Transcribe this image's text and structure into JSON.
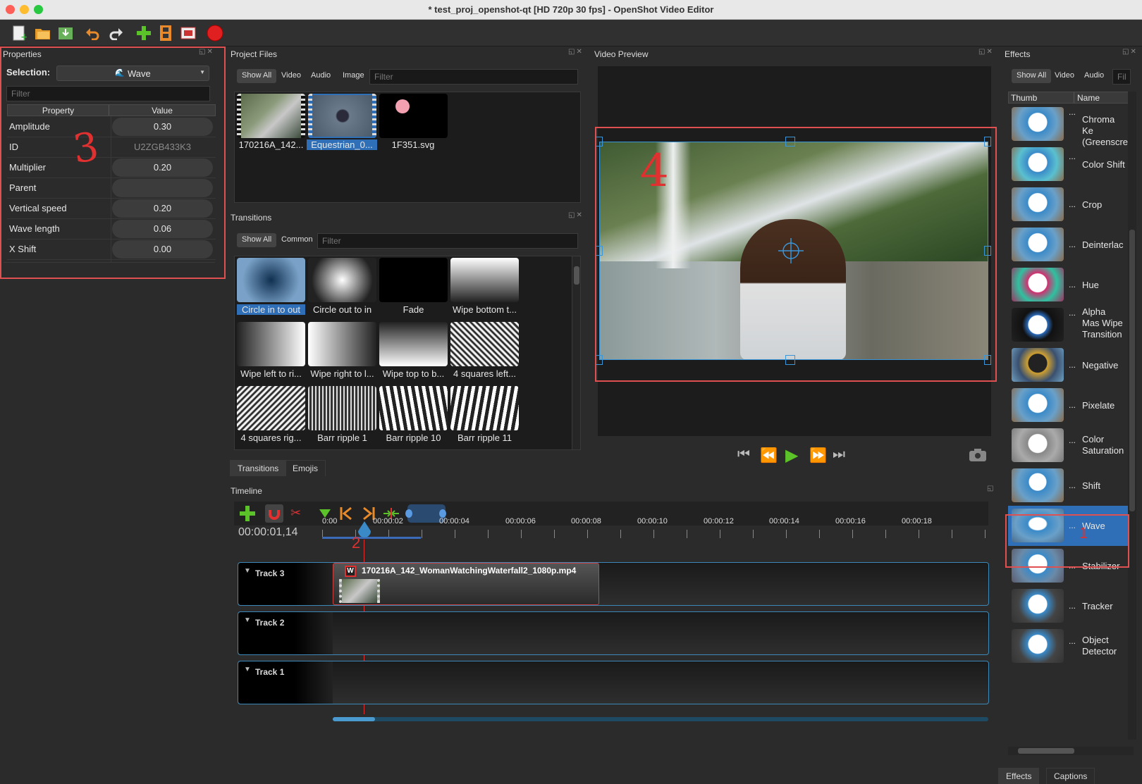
{
  "window": {
    "title": "* test_proj_openshot-qt [HD 720p 30 fps] - OpenShot Video Editor"
  },
  "toolbar": {
    "icons": [
      "new-project-icon",
      "open-project-icon",
      "save-project-icon",
      "undo-icon",
      "redo-icon",
      "import-files-icon",
      "profile-icon",
      "fullscreen-icon",
      "export-video-icon"
    ]
  },
  "properties": {
    "title": "Properties",
    "selection_label": "Selection:",
    "selection_value": "Wave",
    "filter_placeholder": "Filter",
    "col_property": "Property",
    "col_value": "Value",
    "rows": [
      {
        "name": "Amplitude",
        "value": "0.30"
      },
      {
        "name": "ID",
        "value": "U2ZGB433K3"
      },
      {
        "name": "Multiplier",
        "value": "0.20"
      },
      {
        "name": "Parent",
        "value": ""
      },
      {
        "name": "Vertical speed",
        "value": "0.20"
      },
      {
        "name": "Wave length",
        "value": "0.06"
      },
      {
        "name": "X Shift",
        "value": "0.00"
      }
    ]
  },
  "project_files": {
    "title": "Project Files",
    "filters": [
      "Show All",
      "Video",
      "Audio",
      "Image"
    ],
    "filter_placeholder": "Filter",
    "files": [
      {
        "name": "170216A_142..."
      },
      {
        "name": "Equestrian_0..."
      },
      {
        "name": "1F351.svg"
      }
    ]
  },
  "transitions": {
    "title": "Transitions",
    "filters": [
      "Show All",
      "Common"
    ],
    "filter_placeholder": "Filter",
    "items": [
      "Circle in to out",
      "Circle out to in",
      "Fade",
      "Wipe bottom t...",
      "Wipe left to ri...",
      "Wipe right to l...",
      "Wipe top to b...",
      "4 squares left...",
      "4 squares rig...",
      "Barr ripple 1",
      "Barr ripple 10",
      "Barr ripple 11"
    ],
    "tabs": [
      "Transitions",
      "Emojis"
    ]
  },
  "video_preview": {
    "title": "Video Preview",
    "annotation": "4"
  },
  "effects": {
    "title": "Effects",
    "filters": [
      "Show All",
      "Video",
      "Audio"
    ],
    "filter_placeholder": "Fil...",
    "col_thumb": "Thumb",
    "col_name": "Name",
    "items": [
      {
        "dots": "...",
        "name": "Chroma Ke (Greenscre"
      },
      {
        "dots": "...",
        "name": "Color Shift"
      },
      {
        "dots": "...",
        "name": "Crop"
      },
      {
        "dots": "...",
        "name": "Deinterlac"
      },
      {
        "dots": "...",
        "name": "Hue"
      },
      {
        "dots": "...",
        "name": "Alpha Mas Wipe Transition"
      },
      {
        "dots": "...",
        "name": "Negative"
      },
      {
        "dots": "...",
        "name": "Pixelate"
      },
      {
        "dots": "...",
        "name": "Color Saturation"
      },
      {
        "dots": "...",
        "name": "Shift"
      },
      {
        "dots": "...",
        "name": "Wave"
      },
      {
        "dots": "...",
        "name": "Stabilizer"
      },
      {
        "dots": "...",
        "name": "Tracker"
      },
      {
        "dots": "...",
        "name": "Object Detector"
      }
    ],
    "tabs": [
      "Effects",
      "Captions"
    ]
  },
  "timeline": {
    "title": "Timeline",
    "timecode": "00:00:01,14",
    "ruler": [
      "0:00",
      "00:00:02",
      "00:00:04",
      "00:00:06",
      "00:00:08",
      "00:00:10",
      "00:00:12",
      "00:00:14",
      "00:00:16",
      "00:00:18"
    ],
    "tracks": [
      "Track 3",
      "Track 2",
      "Track 1"
    ],
    "clip_name": "170216A_142_WomanWatchingWaterfall2_1080p.mp4",
    "clip_badge": "W"
  },
  "annotations": {
    "properties_mark": "3",
    "clip_mark": "2",
    "effect_mark": "1"
  },
  "colors": {
    "selection": "#2f6fb7",
    "annotation_red": "#e05050",
    "accent_blue": "#3c88b8"
  }
}
